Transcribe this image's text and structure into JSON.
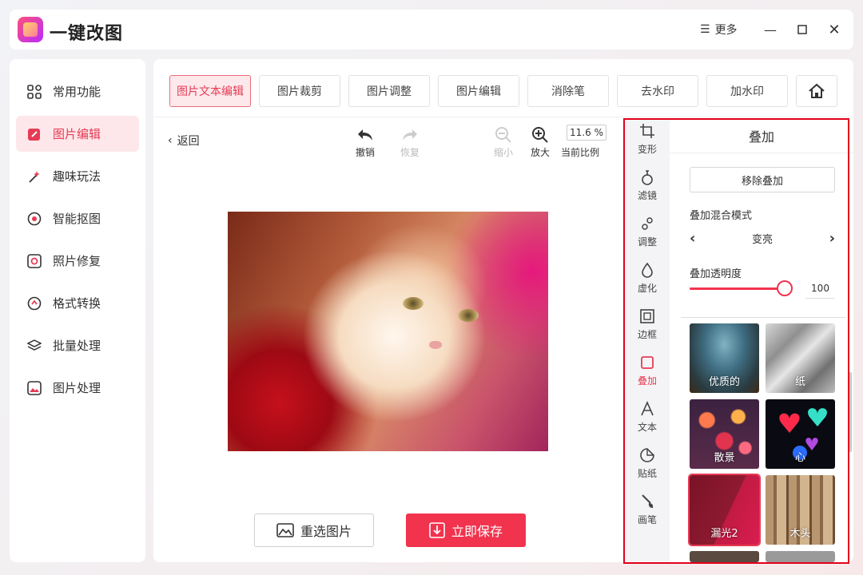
{
  "app": {
    "title": "一键改图",
    "more_label": "更多"
  },
  "sidebar": {
    "items": [
      {
        "label": "常用功能",
        "icon": "grid-icon"
      },
      {
        "label": "图片编辑",
        "icon": "edit-icon"
      },
      {
        "label": "趣味玩法",
        "icon": "magic-wand-icon"
      },
      {
        "label": "智能抠图",
        "icon": "target-icon"
      },
      {
        "label": "照片修复",
        "icon": "repair-icon"
      },
      {
        "label": "格式转换",
        "icon": "convert-icon"
      },
      {
        "label": "批量处理",
        "icon": "layers-icon"
      },
      {
        "label": "图片处理",
        "icon": "image-icon"
      }
    ],
    "active_index": 1
  },
  "tabs": {
    "items": [
      "图片文本编辑",
      "图片裁剪",
      "图片调整",
      "图片编辑",
      "消除笔",
      "去水印",
      "加水印"
    ],
    "active_index": 0
  },
  "toolbar": {
    "back_label": "返回",
    "undo_label": "撤销",
    "redo_label": "恢复",
    "zoom_out_label": "缩小",
    "zoom_in_label": "放大",
    "zoom_value": "11.6 %",
    "zoom_label": "当前比例"
  },
  "actions": {
    "reselect_label": "重选图片",
    "save_label": "立即保存"
  },
  "toolstrip": {
    "items": [
      "变形",
      "滤镜",
      "调整",
      "虚化",
      "边框",
      "叠加",
      "文本",
      "贴纸",
      "画笔"
    ],
    "active_index": 5
  },
  "overlay_panel": {
    "title": "叠加",
    "remove_label": "移除叠加",
    "blend_mode_label": "叠加混合模式",
    "blend_mode_value": "变亮",
    "opacity_label": "叠加透明度",
    "opacity_value": "100",
    "thumbnails": [
      "优质的",
      "纸",
      "散景",
      "心",
      "漏光2",
      "木头"
    ],
    "selected_thumbnail": 4
  },
  "colors": {
    "accent": "#f2334e",
    "accent_light": "#fde7ea",
    "highlight_box": "#e3001b"
  }
}
